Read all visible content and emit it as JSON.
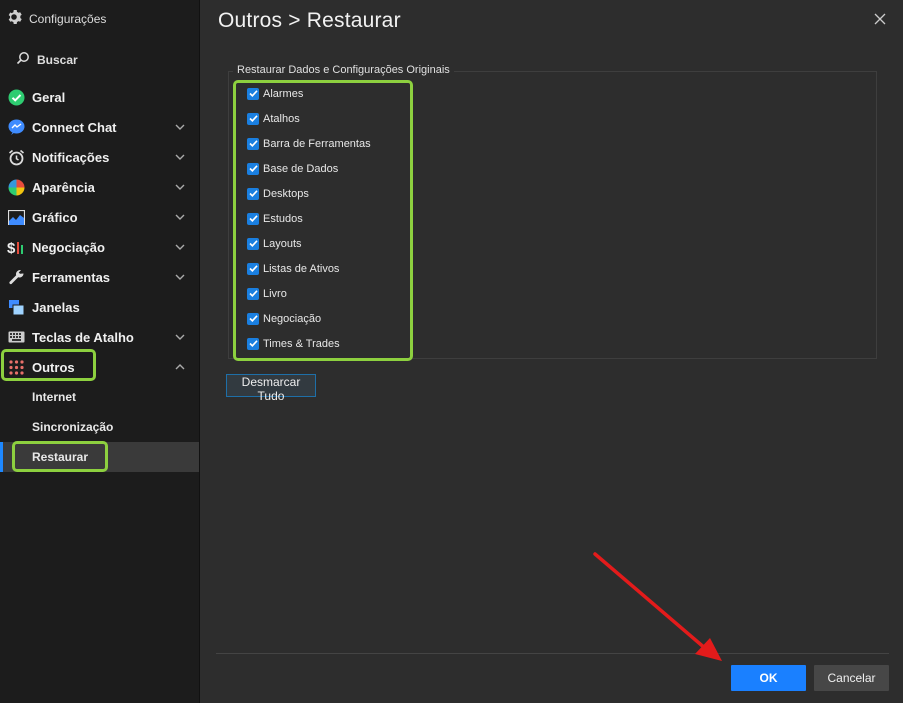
{
  "window": {
    "title": "Configurações",
    "search_label": "Buscar"
  },
  "sidebar": {
    "items": [
      {
        "label": "Geral",
        "icon": "check-circle-icon",
        "expand": false
      },
      {
        "label": "Connect Chat",
        "icon": "chat-icon",
        "expand": true
      },
      {
        "label": "Notificações",
        "icon": "alarm-clock-icon",
        "expand": true
      },
      {
        "label": "Aparência",
        "icon": "palette-icon",
        "expand": true
      },
      {
        "label": "Gráfico",
        "icon": "chart-icon",
        "expand": true
      },
      {
        "label": "Negociação",
        "icon": "dollar-icon",
        "expand": true
      },
      {
        "label": "Ferramentas",
        "icon": "wrench-icon",
        "expand": true
      },
      {
        "label": "Janelas",
        "icon": "windows-icon",
        "expand": false
      },
      {
        "label": "Teclas de Atalho",
        "icon": "keyboard-icon",
        "expand": true
      },
      {
        "label": "Outros",
        "icon": "dots-grid-icon",
        "expand": true,
        "expanded": true
      }
    ],
    "sub_items": [
      {
        "label": "Internet",
        "active": false
      },
      {
        "label": "Sincronização",
        "active": false
      },
      {
        "label": "Restaurar",
        "active": true
      }
    ]
  },
  "main": {
    "title": "Outros > Restaurar",
    "group_label": "Restaurar Dados e Configurações Originais",
    "checkboxes": [
      {
        "label": "Alarmes",
        "checked": true
      },
      {
        "label": "Atalhos",
        "checked": true
      },
      {
        "label": "Barra de Ferramentas",
        "checked": true
      },
      {
        "label": "Base de Dados",
        "checked": true
      },
      {
        "label": "Desktops",
        "checked": true
      },
      {
        "label": "Estudos",
        "checked": true
      },
      {
        "label": "Layouts",
        "checked": true
      },
      {
        "label": "Listas de Ativos",
        "checked": true
      },
      {
        "label": "Livro",
        "checked": true
      },
      {
        "label": "Negociação",
        "checked": true
      },
      {
        "label": "Times & Trades",
        "checked": true
      }
    ],
    "uncheck_all_label": "Desmarcar Tudo"
  },
  "footer": {
    "ok_label": "OK",
    "cancel_label": "Cancelar"
  },
  "colors": {
    "accent": "#1a80ff",
    "highlight": "#8dd03f",
    "annotation_arrow": "#e31b1b",
    "background": "#2d2d2d",
    "sidebar": "#1c1c1c"
  }
}
